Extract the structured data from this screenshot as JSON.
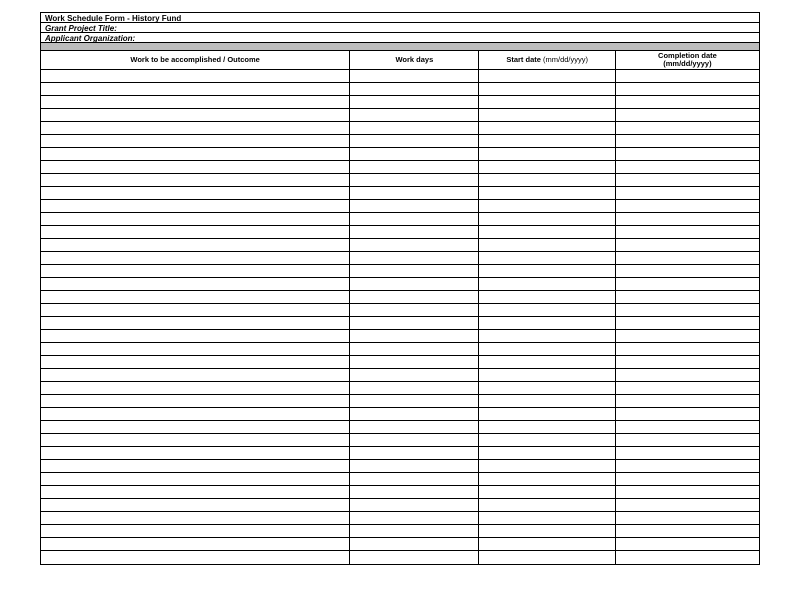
{
  "header": {
    "title": "Work Schedule Form - History Fund",
    "field1_label": "Grant Project Title:",
    "field2_label": "Applicant Organization:"
  },
  "columns": {
    "c0": "Work to be accomplished / Outcome",
    "c1": "Work days",
    "c2_a": "Start date",
    "c2_b": " (mm/dd/yyyy)",
    "c3_a": "Completion date",
    "c3_b": "(mm/dd/yyyy)"
  },
  "rows_count": 38
}
